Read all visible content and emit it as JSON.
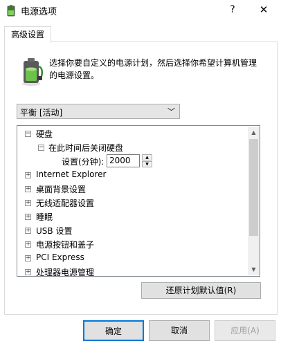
{
  "window": {
    "title": "电源选项",
    "help_label": "?",
    "close_label": "✕"
  },
  "tabs": [
    {
      "label": "高级设置",
      "selected": true
    }
  ],
  "intro": "选择你要自定义的电源计划，然后选择你希望计算机管理的电源设置。",
  "plan_select": {
    "value": "平衡 [活动]",
    "chevron": "﹀"
  },
  "tree": {
    "items": [
      {
        "label": "硬盘",
        "expander": "−"
      },
      {
        "label": "在此时间后关闭硬盘",
        "expander": "−"
      },
      {
        "label": "设置(分钟):",
        "value": "2000"
      },
      {
        "label": "Internet Explorer",
        "expander": "+"
      },
      {
        "label": "桌面背景设置",
        "expander": "+"
      },
      {
        "label": "无线适配器设置",
        "expander": "+"
      },
      {
        "label": "睡眠",
        "expander": "+"
      },
      {
        "label": "USB 设置",
        "expander": "+"
      },
      {
        "label": "电源按钮和盖子",
        "expander": "+"
      },
      {
        "label": "PCI Express",
        "expander": "+"
      },
      {
        "label": "处理器电源管理",
        "expander": "+"
      }
    ],
    "spin_up": "▲",
    "spin_down": "▼",
    "scroll_up": "▲",
    "scroll_down": "▼"
  },
  "buttons": {
    "restore": "还原计划默认值(R)",
    "ok": "确定",
    "cancel": "取消",
    "apply": "应用(A)"
  },
  "colors": {
    "accent": "#0078d7",
    "button_bg": "#e1e1e1",
    "disabled_text": "#a0a0a0"
  }
}
